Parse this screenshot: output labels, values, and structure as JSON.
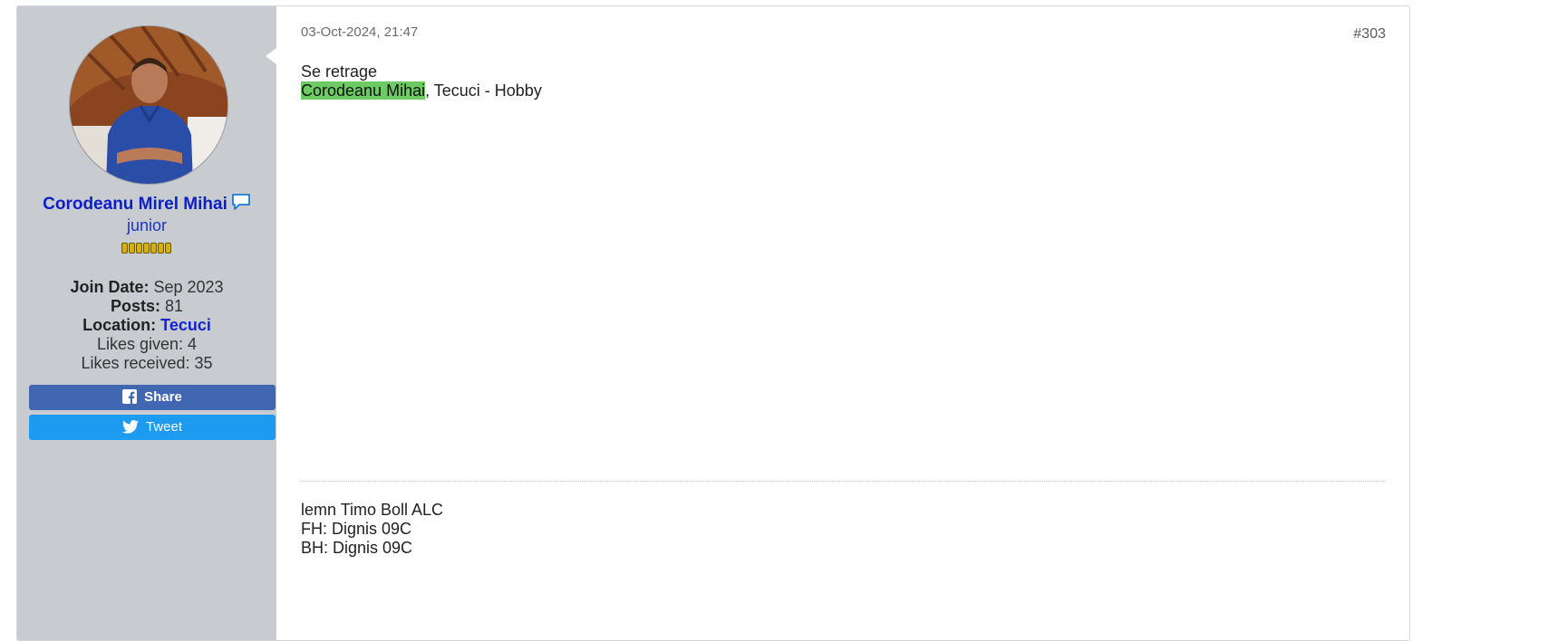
{
  "user": {
    "name": "Corodeanu Mirel Mihai",
    "title": "junior",
    "stats": {
      "join_label": "Join Date:",
      "join_value": "Sep 2023",
      "posts_label": "Posts:",
      "posts_value": "81",
      "location_label": "Location:",
      "location_value": "Tecuci",
      "likes_given": "Likes given: 4",
      "likes_received": "Likes received: 35"
    },
    "reputation_pips": 7
  },
  "buttons": {
    "share": "Share",
    "tweet": "Tweet"
  },
  "post": {
    "date": "03-Oct-2024, 21:47",
    "number": "#303",
    "line1": "Se retrage",
    "highlight_name": "Corodeanu Mihai",
    "line2_rest": ", Tecuci - Hobby"
  },
  "signature": {
    "lines": [
      "lemn Timo Boll ALC",
      "FH: Dignis 09C",
      "BH: Dignis 09C"
    ]
  },
  "colors": {
    "sidebar_bg": "#c8cbcf",
    "username": "#0c1fc7",
    "highlight": "#6ccb63",
    "facebook": "#4267b2",
    "twitter": "#1d9bf0"
  },
  "icons": {
    "chat": "speech-bubble-icon",
    "facebook": "facebook-icon",
    "twitter": "twitter-icon"
  }
}
